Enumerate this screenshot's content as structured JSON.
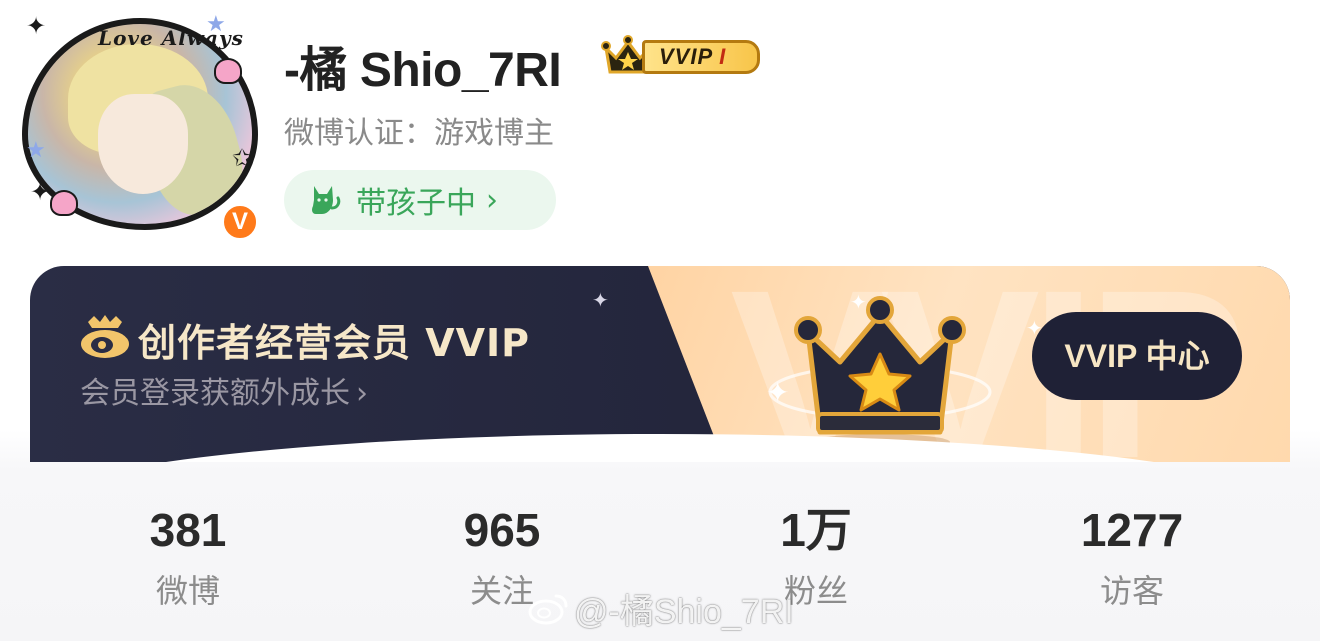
{
  "profile": {
    "avatar_text": "Love Always",
    "username": "-橘 Shio_7RI",
    "vvip_badge": {
      "text": "VVIP",
      "level": "I"
    },
    "verification": "微博认证：游戏博主",
    "status": {
      "label": "带孩子中",
      "icon": "cat-icon"
    }
  },
  "banner": {
    "title": "创作者经营会员 VVIP",
    "subtitle": "会员登录获额外成长",
    "watermark": "VVIP",
    "button_label": "VVIP 中心",
    "icon": "weibo-logo-icon"
  },
  "stats": [
    {
      "value": "381",
      "label": "微博"
    },
    {
      "value": "965",
      "label": "关注"
    },
    {
      "value": "1万",
      "label": "粉丝"
    },
    {
      "value": "1277",
      "label": "访客"
    }
  ],
  "footer_watermark": "@-橘Shio_7RI",
  "colors": {
    "accent_green": "#3aa65a",
    "vip_orange": "#ff7a1a",
    "banner_dark": "#23253b",
    "banner_gold": "#ffc98e"
  }
}
